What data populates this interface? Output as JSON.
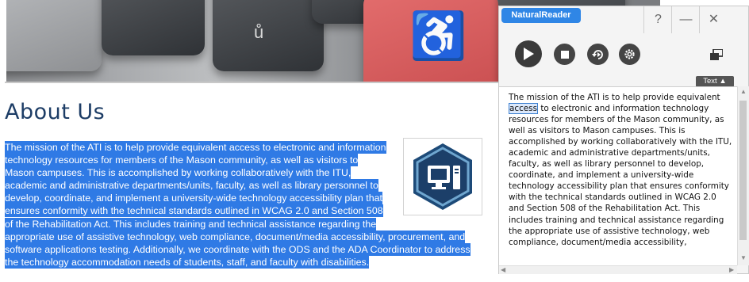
{
  "page": {
    "title": "About Us",
    "body_lines": [
      "The mission of the ATI is to help provide equivalent access to electronic and information",
      "technology resources for members of the Mason community, as well as visitors to",
      "Mason campuses.  This is accomplished by working collaboratively with the ITU,",
      "academic and administrative departments/units, faculty, as well as library personnel to",
      "develop, coordinate, and implement a university-wide technology accessibility plan that",
      "ensures conformity with the technical standards outlined in WCAG 2.0 and Section 508",
      "of the Rehabilitation Act.  This includes training and technical assistance regarding the",
      "appropriate use of assistive technology, web compliance, document/media accessibility, procurement, and",
      "software applications testing.  Additionally, we coordinate with the ODS and the ADA Coordinator to address",
      "the technology accommodation needs of students, staff, and faculty with disabilities."
    ],
    "selection_color": "#2f7ae5",
    "title_color": "#1d3d66",
    "badge_icon": "computer-monitor-icon",
    "hero_icon": "wheelchair-icon"
  },
  "reader": {
    "app_name": "NaturalReader",
    "help_label": "?",
    "minimize_label": "—",
    "close_label": "✕",
    "text_toggle_label": "Text ▲",
    "accent_color": "#2f86e6",
    "controls": [
      "play-icon",
      "stop-icon",
      "rewind-icon",
      "settings-icon",
      "window-mode-icon"
    ],
    "text_lines_pre": "The mission of the ATI is to help provide equivalent",
    "highlighted_word": "access",
    "text_line_2_rest": " to electronic and information technology",
    "text_lines_rest": [
      "resources for members of the Mason community, as",
      "well as visitors to Mason campuses.  This is",
      "accomplished by working collaboratively with the ITU,",
      "academic and administrative departments/units,",
      "faculty, as well as library personnel to develop,",
      "coordinate, and implement a university-wide",
      "technology accessibility plan that ensures conformity",
      "with the technical standards outlined in WCAG 2.0",
      "and Section 508 of the Rehabilitation Act.  This",
      "includes training and technical assistance regarding",
      "the appropriate use of assistive technology, web",
      "compliance, document/media accessibility,"
    ]
  }
}
